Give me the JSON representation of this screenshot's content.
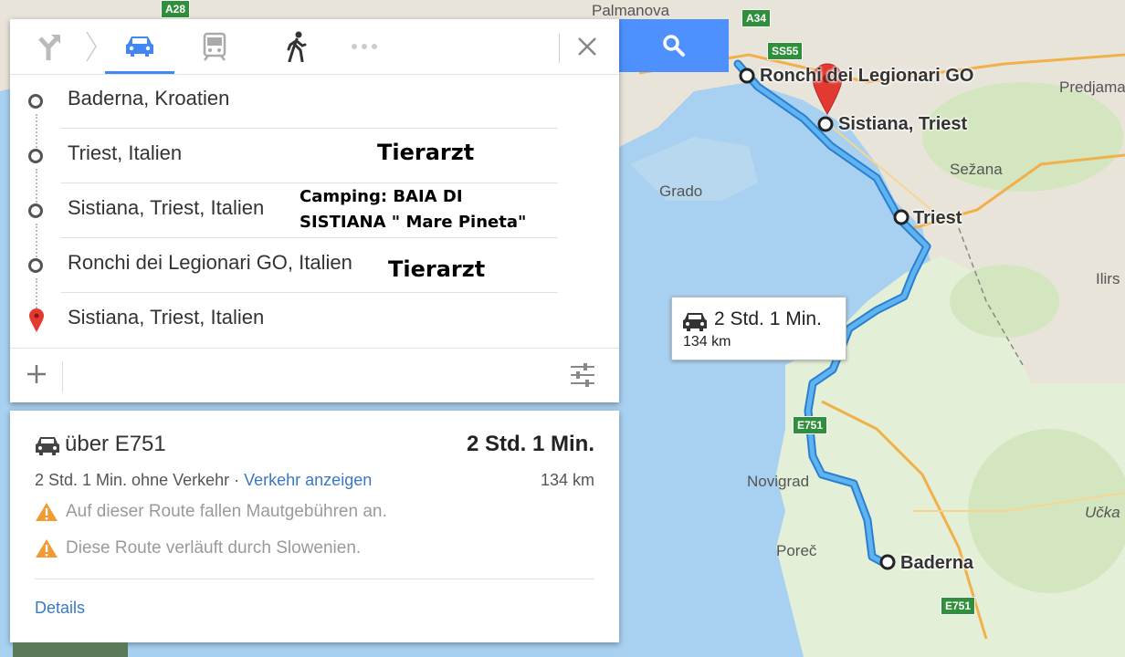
{
  "map": {
    "labels": {
      "palmanova": "Palmanova",
      "ronchi": "Ronchi dei Legionari GO",
      "sistiana": "Sistiana, Triest",
      "predjama": "Predjama",
      "sezana": "Sežana",
      "grado": "Grado",
      "triest": "Triest",
      "ilirs": "Ilirs",
      "novigrad": "Novigrad",
      "porec": "Poreč",
      "baderna": "Baderna",
      "ucka": "Učka"
    },
    "shields": {
      "a28": "A28",
      "a34": "A34",
      "ss55": "SS55",
      "e751_a": "E751",
      "e751_b": "E751"
    },
    "infobox": {
      "duration": "2 Std. 1 Min.",
      "distance": "134 km"
    },
    "colors": {
      "water": "#a8d0f0",
      "land": "#e8e4da",
      "route": "#4aa3e8",
      "pin": "#e23a32"
    }
  },
  "panel": {
    "modes": [
      "best-route",
      "car",
      "transit",
      "walking",
      "more"
    ],
    "stops": [
      {
        "label": "Baderna, Kroatien",
        "note": ""
      },
      {
        "label": "Triest, Italien",
        "note": "Tierarzt"
      },
      {
        "label": "Sistiana, Triest, Italien",
        "note_line1": "Camping: BAIA DI",
        "note_line2": "SISTIANA \" Mare Pineta\""
      },
      {
        "label": "Ronchi dei Legionari GO, Italien",
        "note": "Tierarzt"
      },
      {
        "label": "Sistiana, Triest, Italien",
        "note": ""
      }
    ]
  },
  "route": {
    "via": "über E751",
    "duration": "2 Std. 1 Min.",
    "subtitle_plain": "2 Std. 1 Min. ohne Verkehr · ",
    "traffic_link": "Verkehr anzeigen",
    "distance": "134 km",
    "warnings": [
      "Auf dieser Route fallen Mautgebühren an.",
      "Diese Route verläuft durch Slowenien."
    ],
    "details": "Details"
  }
}
